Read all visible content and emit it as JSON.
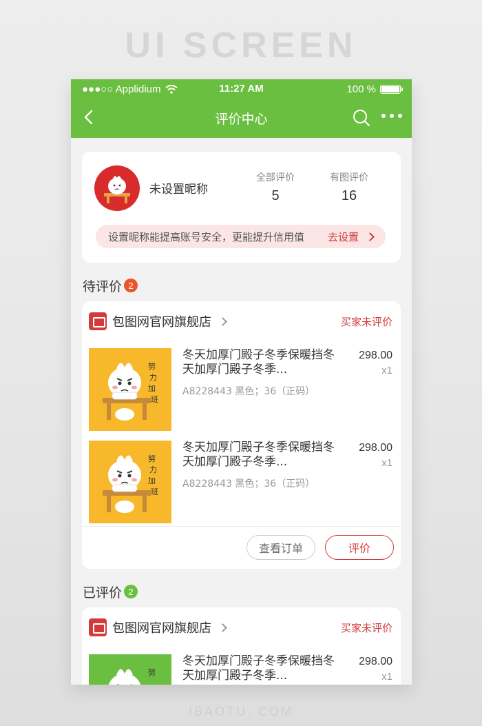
{
  "watermark": {
    "title": "UI SCREEN",
    "footer": "IBAOTU. COM"
  },
  "statusbar": {
    "carrier": "●●●○○ Applidium",
    "time": "11:27 AM",
    "battery": "100 %"
  },
  "navbar": {
    "title": "评价中心",
    "icons": [
      "back-chevron-icon",
      "search-icon",
      "more-icon"
    ]
  },
  "profile": {
    "nickname": "未设置昵称",
    "stats": [
      {
        "label": "全部评价",
        "value": "5"
      },
      {
        "label": "有图评价",
        "value": "16"
      }
    ],
    "tip_text": "设置昵称能提高账号安全，更能提升信用值",
    "tip_action": "去设置"
  },
  "pending": {
    "title": "待评价",
    "count": "2",
    "order": {
      "store": "包图网官网旗舰店",
      "status": "买家未评价",
      "items": [
        {
          "title": "冬天加厚门殿子冬季保暖挡冬天加厚门殿子冬季...",
          "sku": "A8228443 黑色；36（正码）",
          "price": "298.00",
          "qty": "x1"
        },
        {
          "title": "冬天加厚门殿子冬季保暖挡冬天加厚门殿子冬季...",
          "sku": "A8228443 黑色；36（正码）",
          "price": "298.00",
          "qty": "x1"
        }
      ],
      "view_label": "查看订单",
      "review_label": "评价"
    }
  },
  "reviewed": {
    "title": "已评价",
    "count": "2",
    "order": {
      "store": "包图网官网旗舰店",
      "status": "买家未评价",
      "items": [
        {
          "title": "冬天加厚门殿子冬季保暖挡冬天加厚门殿子冬季...",
          "price": "298.00",
          "qty": "x1"
        }
      ]
    }
  },
  "colors": {
    "brand_green": "#6abf40",
    "accent_red": "#d23b3b",
    "thumb_yellow": "#f7b92b",
    "thumb_green": "#6abf40"
  }
}
